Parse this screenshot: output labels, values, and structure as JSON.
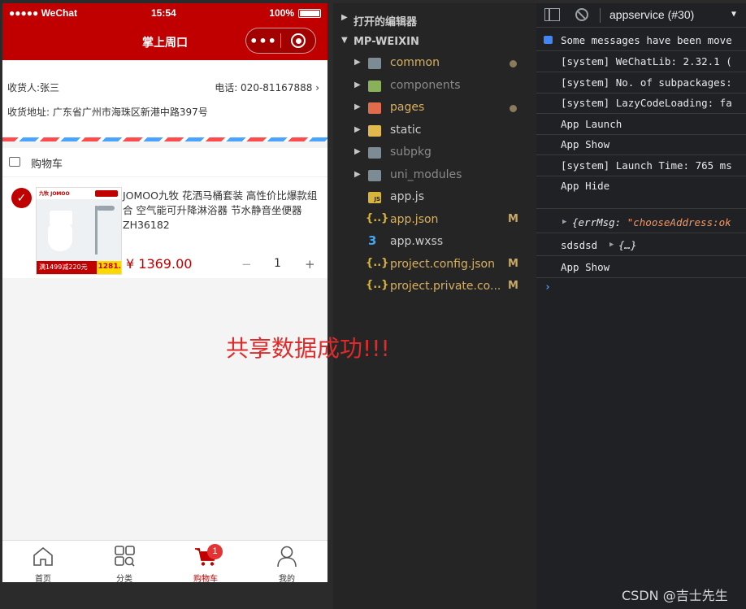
{
  "phone": {
    "status": {
      "carrier": "●●●●● WeChat",
      "time": "15:54",
      "battery": "100%"
    },
    "nav": {
      "title": "掌上周口",
      "more": "•••"
    },
    "address": {
      "consignee": "收货人:张三",
      "phone": "电话: 020-81167888",
      "address": "收货地址: 广东省广州市海珠区新港中路397号"
    },
    "cart_header": "购物车",
    "item": {
      "name": "JOMOO九牧 花洒马桶套装 高性价比爆款组合 空气能可升降淋浴器 节水静音坐便器 ZH36182",
      "price": "¥ 1369.00",
      "quantity": "1",
      "minus": "−",
      "plus": "+",
      "thumb_brand": "九牧 JOMOO",
      "thumb_promo": "满1499减220元",
      "thumb_price": "1281."
    },
    "tabs": [
      {
        "label": "首页",
        "icon": "home-icon"
      },
      {
        "label": "分类",
        "icon": "category-icon"
      },
      {
        "label": "购物车",
        "icon": "cart-icon",
        "badge": "1"
      },
      {
        "label": "我的",
        "icon": "user-icon"
      }
    ],
    "accent": "#c00000"
  },
  "overlay_text": "共享数据成功!!!",
  "explorer": {
    "open_editors": "打开的编辑器",
    "project": "MP-WEIXIN",
    "files": [
      {
        "name": "common",
        "modified_dot": true
      },
      {
        "name": "components",
        "modified_dot": false
      },
      {
        "name": "pages",
        "modified_dot": true
      },
      {
        "name": "static",
        "modified_dot": false
      },
      {
        "name": "subpkg",
        "modified_dot": false
      },
      {
        "name": "uni_modules",
        "modified_dot": false
      },
      {
        "name": "app.js",
        "mark": ""
      },
      {
        "name": "app.json",
        "mark": "M"
      },
      {
        "name": "app.wxss",
        "mark": ""
      },
      {
        "name": "project.config.json",
        "mark": "M"
      },
      {
        "name": "project.private.co...",
        "mark": "M"
      }
    ]
  },
  "console": {
    "context": "appservice (#30)",
    "logs": [
      "Some messages have been move",
      "[system] WeChatLib: 2.32.1 (",
      "[system] No. of subpackages:",
      "[system] LazyCodeLoading: fa",
      "App Launch",
      "App Show",
      "[system] Launch Time: 765 ms",
      "App Hide"
    ],
    "obj_key": "{errMsg: ",
    "obj_val": "\"chooseAddress:ok",
    "sds_label": "sdsdsd",
    "sds_obj": "{…}",
    "last": "App Show",
    "prompt": "›"
  },
  "watermark": "CSDN @吉士先生"
}
